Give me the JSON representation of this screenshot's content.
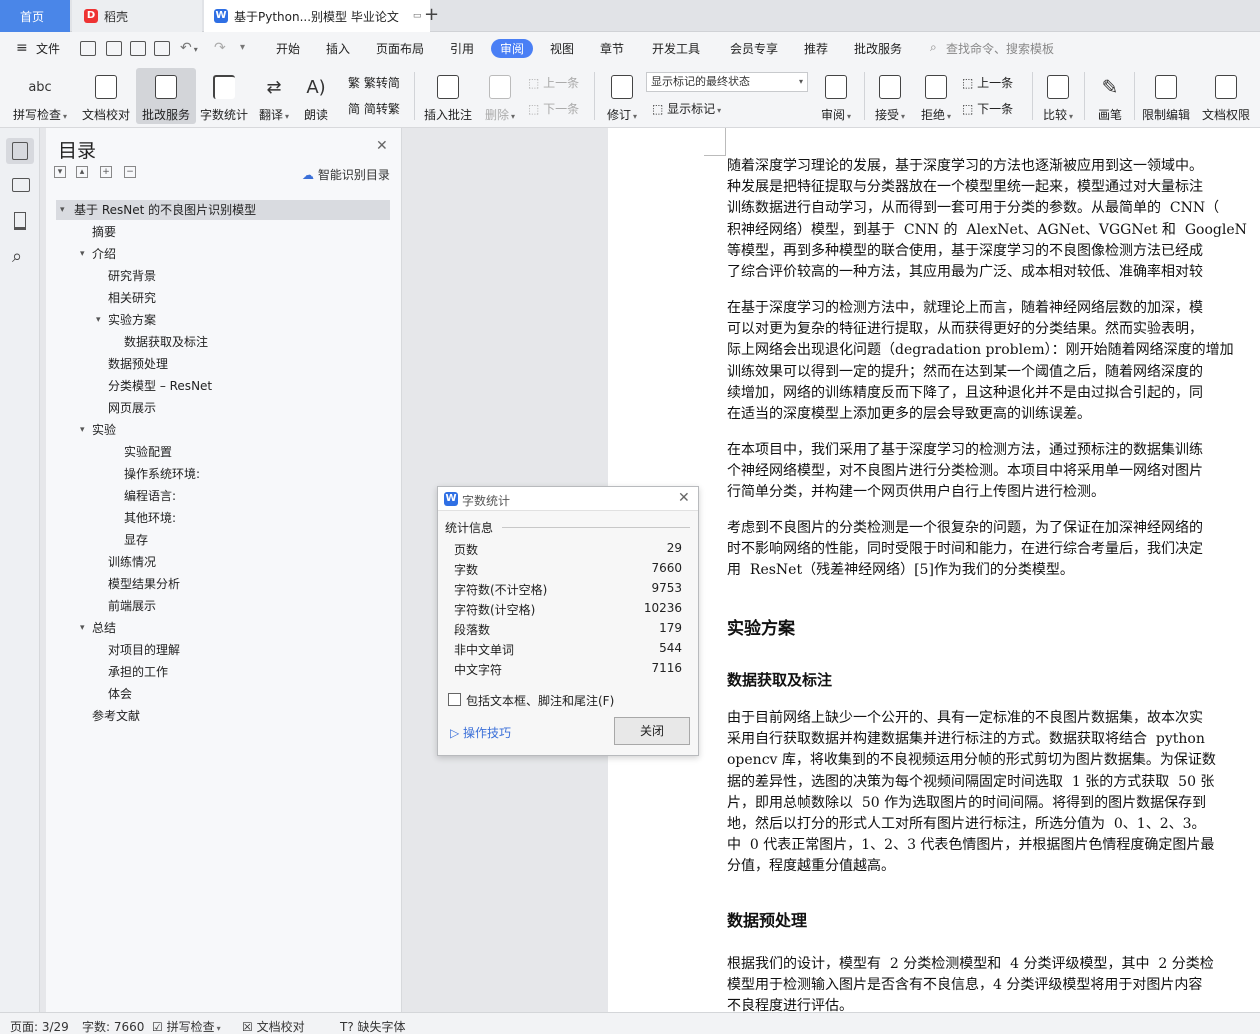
{
  "tabs": {
    "home": "首页",
    "shell": "稻壳",
    "doc": "基于Python...别模型 毕业论文"
  },
  "menu": {
    "file": "文件",
    "items": [
      "开始",
      "插入",
      "页面布局",
      "引用",
      "审阅",
      "视图",
      "章节",
      "开发工具",
      "会员专享",
      "推荐",
      "批改服务"
    ],
    "active": "审阅",
    "search": "查找命令、搜索模板"
  },
  "toolbar": {
    "spell": "拼写检查",
    "proof": "文档校对",
    "correct": "批改服务",
    "wordcount": "字数统计",
    "translate": "翻译",
    "read": "朗读",
    "trad": "繁转简",
    "simp": "简转繁",
    "insert_comment": "插入批注",
    "delete": "删除",
    "prev_c": "上一条",
    "next_c": "下一条",
    "revise": "修订",
    "mark_state": "显示标记的最终状态",
    "show_mark": "显示标记",
    "review": "审阅",
    "accept": "接受",
    "reject": "拒绝",
    "prev": "上一条",
    "next": "下一条",
    "compare": "比较",
    "pen": "画笔",
    "restrict": "限制编辑",
    "perm": "文档权限"
  },
  "nav": {
    "title": "目录",
    "smart": "智能识别目录",
    "items": [
      {
        "text": "基于 ResNet 的不良图片识别模型",
        "level": 0,
        "caret": true
      },
      {
        "text": "摘要",
        "level": 1,
        "caret": false
      },
      {
        "text": "介绍",
        "level": 1,
        "caret": true
      },
      {
        "text": "研究背景",
        "level": 2,
        "caret": false
      },
      {
        "text": "相关研究",
        "level": 2,
        "caret": false
      },
      {
        "text": "实验方案",
        "level": 2,
        "caret": true
      },
      {
        "text": "数据获取及标注",
        "level": 3,
        "caret": false
      },
      {
        "text": "数据预处理",
        "level": 2,
        "caret": false
      },
      {
        "text": "分类模型 – ResNet",
        "level": 2,
        "caret": false
      },
      {
        "text": "网页展示",
        "level": 2,
        "caret": false
      },
      {
        "text": "实验",
        "level": 1,
        "caret": true
      },
      {
        "text": "实验配置",
        "level": 3,
        "caret": false
      },
      {
        "text": "操作系统环境:",
        "level": 3,
        "caret": false
      },
      {
        "text": "编程语言:",
        "level": 3,
        "caret": false
      },
      {
        "text": "其他环境:",
        "level": 3,
        "caret": false
      },
      {
        "text": "显存",
        "level": 3,
        "caret": false
      },
      {
        "text": "训练情况",
        "level": 2,
        "caret": false
      },
      {
        "text": "模型结果分析",
        "level": 2,
        "caret": false
      },
      {
        "text": "前端展示",
        "level": 2,
        "caret": false
      },
      {
        "text": "总结",
        "level": 1,
        "caret": true
      },
      {
        "text": "对项目的理解",
        "level": 2,
        "caret": false
      },
      {
        "text": "承担的工作",
        "level": 2,
        "caret": false
      },
      {
        "text": "体会",
        "level": 2,
        "caret": false
      },
      {
        "text": "参考文献",
        "level": 1,
        "caret": false
      }
    ]
  },
  "doc": {
    "p1": "随着深度学习理论的发展，基于深度学习的方法也逐渐被应用到这一领域中。\n种发展是把特征提取与分类器放在一个模型里统一起来，模型通过对大量标注\n训练数据进行自动学习，从而得到一套可用于分类的参数。从最简单的  CNN（\n积神经网络）模型，到基于  CNN 的  AlexNet、AGNet、VGGNet 和  GoogleN\n等模型，再到多种模型的联合使用，基于深度学习的不良图像检测方法已经成\n了综合评价较高的一种方法，其应用最为广泛、成本相对较低、准确率相对较",
    "p2": "在基于深度学习的检测方法中，就理论上而言，随着神经网络层数的加深，模\n可以对更为复杂的特征进行提取，从而获得更好的分类结果。然而实验表明，\n际上网络会出现退化问题（degradation problem）：刚开始随着网络深度的增加\n训练效果可以得到一定的提升；然而在达到某一个阈值之后，随着网络深度的\n续增加，网络的训练精度反而下降了，且这种退化并不是由过拟合引起的，同\n在适当的深度模型上添加更多的层会导致更高的训练误差。",
    "p3": "在本项目中，我们采用了基于深度学习的检测方法，通过预标注的数据集训练\n个神经网络模型，对不良图片进行分类检测。本项目中将采用单一网络对图片\n行简单分类，并构建一个网页供用户自行上传图片进行检测。",
    "p4": "考虑到不良图片的分类检测是一个很复杂的问题，为了保证在加深神经网络的\n时不影响网络的性能，同时受限于时间和能力，在进行综合考量后，我们决定\n用  ResNet（残差神经网络）[5]作为我们的分类模型。",
    "h1": "实验方案",
    "h2": "数据获取及标注",
    "p5": "由于目前网络上缺少一个公开的、具有一定标准的不良图片数据集，故本次实\n采用自行获取数据并构建数据集并进行标注的方式。数据获取将结合  python\nopencv 库，将收集到的不良视频运用分帧的形式剪切为图片数据集。为保证数\n据的差异性，选图的决策为每个视频间隔固定时间选取  1 张的方式获取  50 张\n片，即用总帧数除以  50 作为选取图片的时间间隔。将得到的图片数据保存到\n地，然后以打分的形式人工对所有图片进行标注，所选分值为  0、1、2、3。\n中  0 代表正常图片，1、2、3 代表色情图片，并根据图片色情程度确定图片最\n分值，程度越重分值越高。",
    "h3": "数据预处理",
    "p6": "根据我们的设计，模型有  2 分类检测模型和  4 分类评级模型，其中  2 分类检\n模型用于检测输入图片是否含有不良信息，4 分类评级模型将用于对图片内容\n不良程度进行评估。"
  },
  "dialog": {
    "title": "字数统计",
    "section": "统计信息",
    "rows": [
      {
        "k": "页数",
        "v": "29"
      },
      {
        "k": "字数",
        "v": "7660"
      },
      {
        "k": "字符数(不计空格)",
        "v": "9753"
      },
      {
        "k": "字符数(计空格)",
        "v": "10236"
      },
      {
        "k": "段落数",
        "v": "179"
      },
      {
        "k": "非中文单词",
        "v": "544"
      },
      {
        "k": "中文字符",
        "v": "7116"
      }
    ],
    "checkbox": "包括文本框、脚注和尾注(F)",
    "tips": "操作技巧",
    "close": "关闭"
  },
  "status": {
    "page": "页面: 3/29",
    "words": "字数: 7660",
    "spell": "拼写检查",
    "proof": "文档校对",
    "font": "缺失字体"
  },
  "colors": {
    "accent": "#4a7ff5",
    "tab_home": "#4a86e8",
    "link": "#3a6fd8"
  }
}
